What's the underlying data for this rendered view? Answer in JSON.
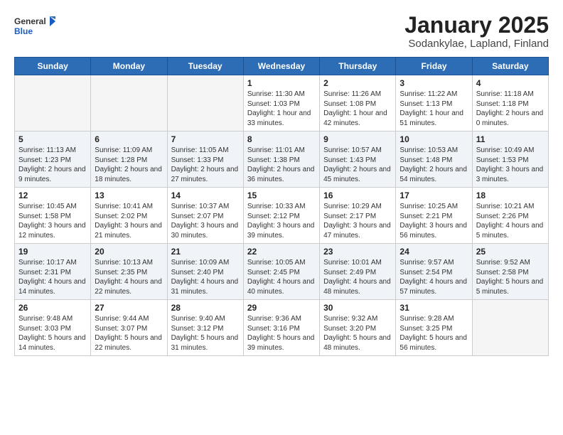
{
  "header": {
    "logo_general": "General",
    "logo_blue": "Blue",
    "title": "January 2025",
    "subtitle": "Sodankylae, Lapland, Finland"
  },
  "weekdays": [
    "Sunday",
    "Monday",
    "Tuesday",
    "Wednesday",
    "Thursday",
    "Friday",
    "Saturday"
  ],
  "weeks": [
    [
      {
        "day": "",
        "info": ""
      },
      {
        "day": "",
        "info": ""
      },
      {
        "day": "",
        "info": ""
      },
      {
        "day": "1",
        "info": "Sunrise: 11:30 AM\nSunset: 1:03 PM\nDaylight: 1 hour and 33 minutes."
      },
      {
        "day": "2",
        "info": "Sunrise: 11:26 AM\nSunset: 1:08 PM\nDaylight: 1 hour and 42 minutes."
      },
      {
        "day": "3",
        "info": "Sunrise: 11:22 AM\nSunset: 1:13 PM\nDaylight: 1 hour and 51 minutes."
      },
      {
        "day": "4",
        "info": "Sunrise: 11:18 AM\nSunset: 1:18 PM\nDaylight: 2 hours and 0 minutes."
      }
    ],
    [
      {
        "day": "5",
        "info": "Sunrise: 11:13 AM\nSunset: 1:23 PM\nDaylight: 2 hours and 9 minutes."
      },
      {
        "day": "6",
        "info": "Sunrise: 11:09 AM\nSunset: 1:28 PM\nDaylight: 2 hours and 18 minutes."
      },
      {
        "day": "7",
        "info": "Sunrise: 11:05 AM\nSunset: 1:33 PM\nDaylight: 2 hours and 27 minutes."
      },
      {
        "day": "8",
        "info": "Sunrise: 11:01 AM\nSunset: 1:38 PM\nDaylight: 2 hours and 36 minutes."
      },
      {
        "day": "9",
        "info": "Sunrise: 10:57 AM\nSunset: 1:43 PM\nDaylight: 2 hours and 45 minutes."
      },
      {
        "day": "10",
        "info": "Sunrise: 10:53 AM\nSunset: 1:48 PM\nDaylight: 2 hours and 54 minutes."
      },
      {
        "day": "11",
        "info": "Sunrise: 10:49 AM\nSunset: 1:53 PM\nDaylight: 3 hours and 3 minutes."
      }
    ],
    [
      {
        "day": "12",
        "info": "Sunrise: 10:45 AM\nSunset: 1:58 PM\nDaylight: 3 hours and 12 minutes."
      },
      {
        "day": "13",
        "info": "Sunrise: 10:41 AM\nSunset: 2:02 PM\nDaylight: 3 hours and 21 minutes."
      },
      {
        "day": "14",
        "info": "Sunrise: 10:37 AM\nSunset: 2:07 PM\nDaylight: 3 hours and 30 minutes."
      },
      {
        "day": "15",
        "info": "Sunrise: 10:33 AM\nSunset: 2:12 PM\nDaylight: 3 hours and 39 minutes."
      },
      {
        "day": "16",
        "info": "Sunrise: 10:29 AM\nSunset: 2:17 PM\nDaylight: 3 hours and 47 minutes."
      },
      {
        "day": "17",
        "info": "Sunrise: 10:25 AM\nSunset: 2:21 PM\nDaylight: 3 hours and 56 minutes."
      },
      {
        "day": "18",
        "info": "Sunrise: 10:21 AM\nSunset: 2:26 PM\nDaylight: 4 hours and 5 minutes."
      }
    ],
    [
      {
        "day": "19",
        "info": "Sunrise: 10:17 AM\nSunset: 2:31 PM\nDaylight: 4 hours and 14 minutes."
      },
      {
        "day": "20",
        "info": "Sunrise: 10:13 AM\nSunset: 2:35 PM\nDaylight: 4 hours and 22 minutes."
      },
      {
        "day": "21",
        "info": "Sunrise: 10:09 AM\nSunset: 2:40 PM\nDaylight: 4 hours and 31 minutes."
      },
      {
        "day": "22",
        "info": "Sunrise: 10:05 AM\nSunset: 2:45 PM\nDaylight: 4 hours and 40 minutes."
      },
      {
        "day": "23",
        "info": "Sunrise: 10:01 AM\nSunset: 2:49 PM\nDaylight: 4 hours and 48 minutes."
      },
      {
        "day": "24",
        "info": "Sunrise: 9:57 AM\nSunset: 2:54 PM\nDaylight: 4 hours and 57 minutes."
      },
      {
        "day": "25",
        "info": "Sunrise: 9:52 AM\nSunset: 2:58 PM\nDaylight: 5 hours and 5 minutes."
      }
    ],
    [
      {
        "day": "26",
        "info": "Sunrise: 9:48 AM\nSunset: 3:03 PM\nDaylight: 5 hours and 14 minutes."
      },
      {
        "day": "27",
        "info": "Sunrise: 9:44 AM\nSunset: 3:07 PM\nDaylight: 5 hours and 22 minutes."
      },
      {
        "day": "28",
        "info": "Sunrise: 9:40 AM\nSunset: 3:12 PM\nDaylight: 5 hours and 31 minutes."
      },
      {
        "day": "29",
        "info": "Sunrise: 9:36 AM\nSunset: 3:16 PM\nDaylight: 5 hours and 39 minutes."
      },
      {
        "day": "30",
        "info": "Sunrise: 9:32 AM\nSunset: 3:20 PM\nDaylight: 5 hours and 48 minutes."
      },
      {
        "day": "31",
        "info": "Sunrise: 9:28 AM\nSunset: 3:25 PM\nDaylight: 5 hours and 56 minutes."
      },
      {
        "day": "",
        "info": ""
      }
    ]
  ]
}
